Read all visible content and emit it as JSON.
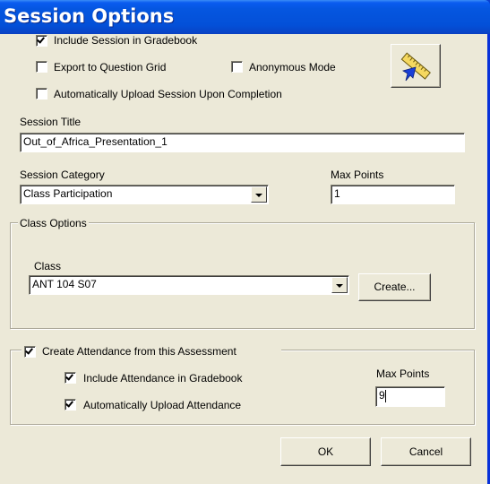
{
  "window": {
    "title": "Session Options"
  },
  "options": {
    "include_session_gradebook": {
      "label": "Include Session in Gradebook",
      "checked": true
    },
    "export_question_grid": {
      "label": "Export to Question Grid",
      "checked": false
    },
    "anonymous_mode": {
      "label": "Anonymous Mode",
      "checked": false
    },
    "auto_upload_session": {
      "label": "Automatically Upload Session Upon Completion",
      "checked": false
    }
  },
  "toolbar": {
    "ruler_button_icon": "ruler-pointer-icon"
  },
  "session_title": {
    "label": "Session Title",
    "value": "Out_of_Africa_Presentation_1"
  },
  "session_category": {
    "label": "Session Category",
    "value": "Class Participation"
  },
  "max_points": {
    "label": "Max Points",
    "value": "1"
  },
  "class_options": {
    "group_label": "Class Options",
    "class_label": "Class",
    "class_value": "ANT 104 S07",
    "create_button": "Create..."
  },
  "attendance": {
    "create_label": "Create Attendance from this Assessment",
    "create_checked": true,
    "include_gradebook_label": "Include Attendance in Gradebook",
    "include_gradebook_checked": true,
    "auto_upload_label": "Automatically Upload Attendance",
    "auto_upload_checked": true,
    "max_points_label": "Max Points",
    "max_points_value": "9"
  },
  "footer": {
    "ok": "OK",
    "cancel": "Cancel"
  }
}
